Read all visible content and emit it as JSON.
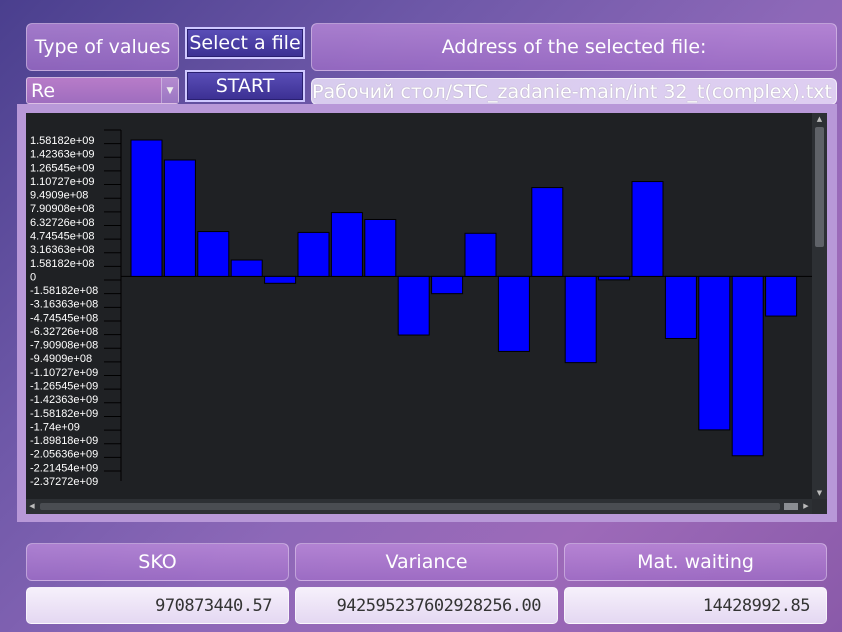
{
  "controls": {
    "type_label": "Type of values",
    "type_selected": "Re",
    "select_file_button": "Select a file",
    "start_button": "START",
    "address_label": "Address of the selected file:",
    "address_value": "Рабочий стол/STC_zadanie-main/int 32_t(complex).txt"
  },
  "stats": {
    "sko_label": "SKO",
    "sko_value": "970873440.57",
    "variance_label": "Variance",
    "variance_value": "942595237602928256.00",
    "mean_label": "Mat. waiting",
    "mean_value": "14428992.85"
  },
  "colors": {
    "bar": "#0000ff",
    "plot_bg": "#1f2124"
  },
  "chart_data": {
    "type": "bar",
    "ylim": [
      -2372720000,
      1581820000
    ],
    "yticks": [
      "1.58182e+09",
      "1.42363e+09",
      "1.26545e+09",
      "1.10727e+09",
      "9.4909e+08",
      "7.90908e+08",
      "6.32726e+08",
      "4.74545e+08",
      "3.16363e+08",
      "1.58182e+08",
      "0",
      "-1.58182e+08",
      "-3.16363e+08",
      "-4.74545e+08",
      "-6.32726e+08",
      "-7.90908e+08",
      "-9.4909e+08",
      "-1.10727e+09",
      "-1.26545e+09",
      "-1.42363e+09",
      "-1.58182e+09",
      "-1.74e+09",
      "-1.89818e+09",
      "-2.05636e+09",
      "-2.21454e+09",
      "-2.37272e+09"
    ],
    "values": [
      1581820000,
      1350000000,
      520000000,
      190000000,
      -80000000,
      510000000,
      740000000,
      660000000,
      -680000000,
      -200000000,
      500000000,
      -870000000,
      1030000000,
      -1000000000,
      -40000000,
      1100000000,
      -720000000,
      -1780000000,
      -2080000000,
      -460000000
    ],
    "grid": false
  }
}
